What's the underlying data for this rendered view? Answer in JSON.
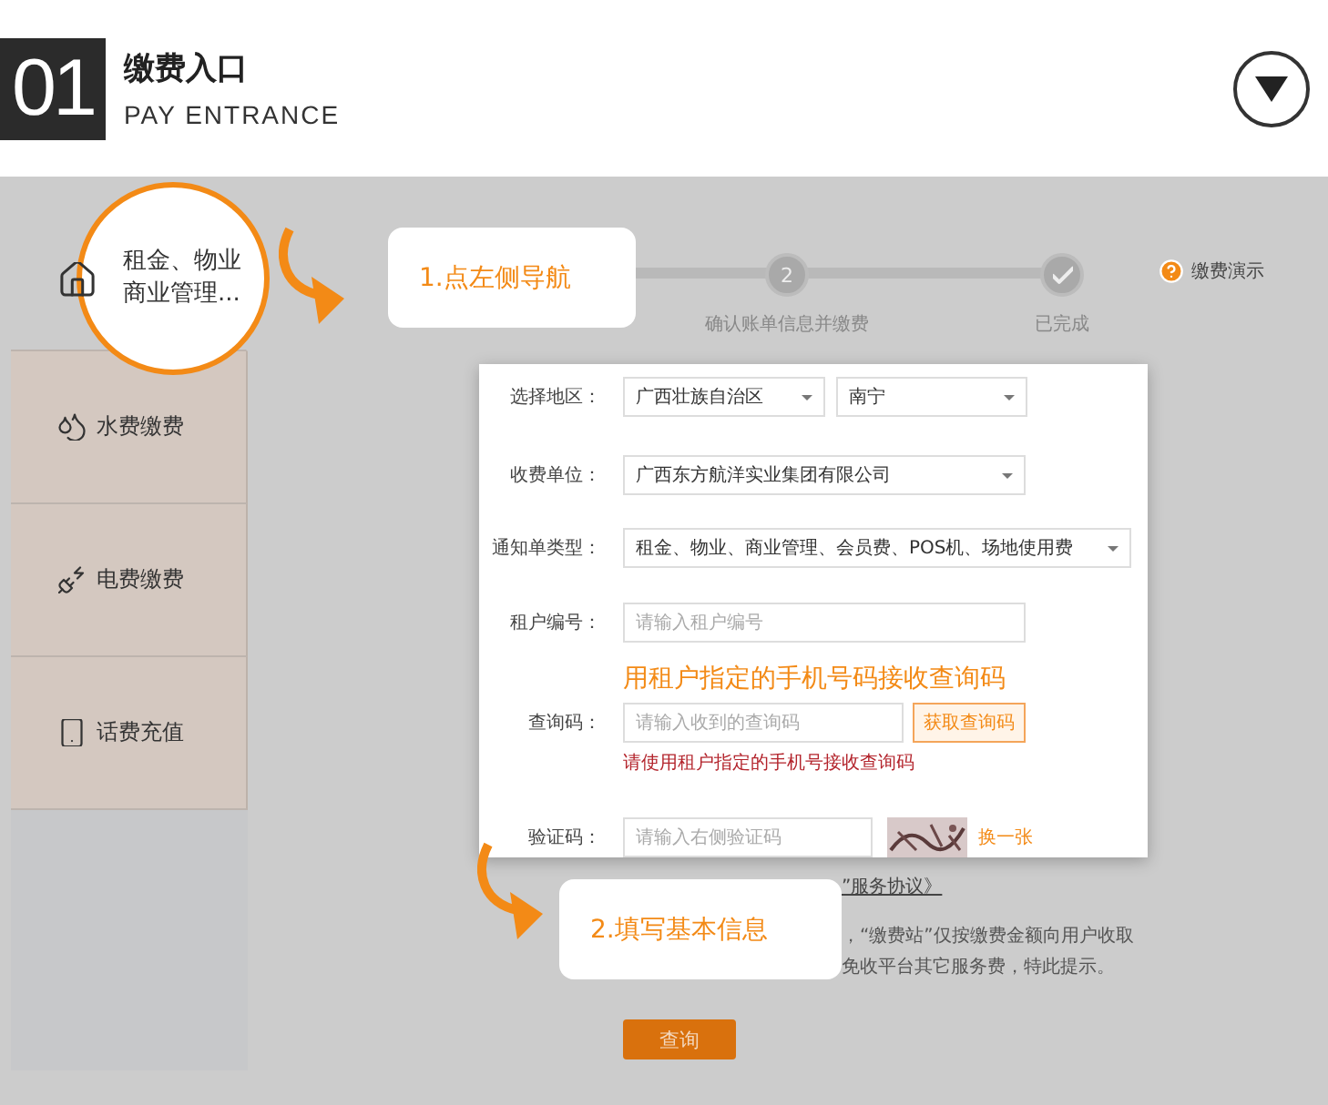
{
  "header": {
    "number": "01",
    "title": "缴费入口",
    "subtitle": "PAY ENTRANCE"
  },
  "sidebar": {
    "items": [
      {
        "lines": [
          "租金、物业",
          "商业管理..."
        ],
        "selected": true
      },
      {
        "label": "水费缴费",
        "selected": false
      },
      {
        "label": "电费缴费",
        "selected": false
      },
      {
        "label": "话费充值",
        "selected": false
      }
    ]
  },
  "steps": [
    {
      "kind": "number",
      "number": "2",
      "label": "确认账单信息并缴费"
    },
    {
      "kind": "check",
      "label": "已完成"
    }
  ],
  "help": "缴费演示",
  "callouts": [
    "1.点左侧导航",
    "2.填写基本信息"
  ],
  "form": {
    "rows": [
      {
        "kind": "selects",
        "label": "选择地区：",
        "values": [
          "广西壮族自治区",
          "南宁"
        ]
      },
      {
        "kind": "select",
        "label": "收费单位：",
        "value": "广西东方航洋实业集团有限公司"
      },
      {
        "kind": "select_wide",
        "label": "通知单类型：",
        "value": "租金、物业、商业管理、会员费、POS机、场地使用费"
      },
      {
        "kind": "input",
        "label": "租户编号：",
        "placeholder": "请输入租户编号"
      },
      {
        "kind": "annotation",
        "text": "用租户指定的手机号码接收查询码"
      },
      {
        "kind": "input_button",
        "label": "查询码：",
        "placeholder": "请输入收到的查询码",
        "button": "获取查询码",
        "hint": "请使用租户指定的手机号接收查询码"
      },
      {
        "kind": "captcha",
        "label": "验证码：",
        "placeholder": "请输入右侧验证码",
        "link": "换一张"
      }
    ]
  },
  "agreement": "”服务协议》",
  "notes": [
    "，“缴费站”仅按缴费金额向用户收取",
    "免收平台其它服务费，特此提示。"
  ],
  "submit": "查询"
}
